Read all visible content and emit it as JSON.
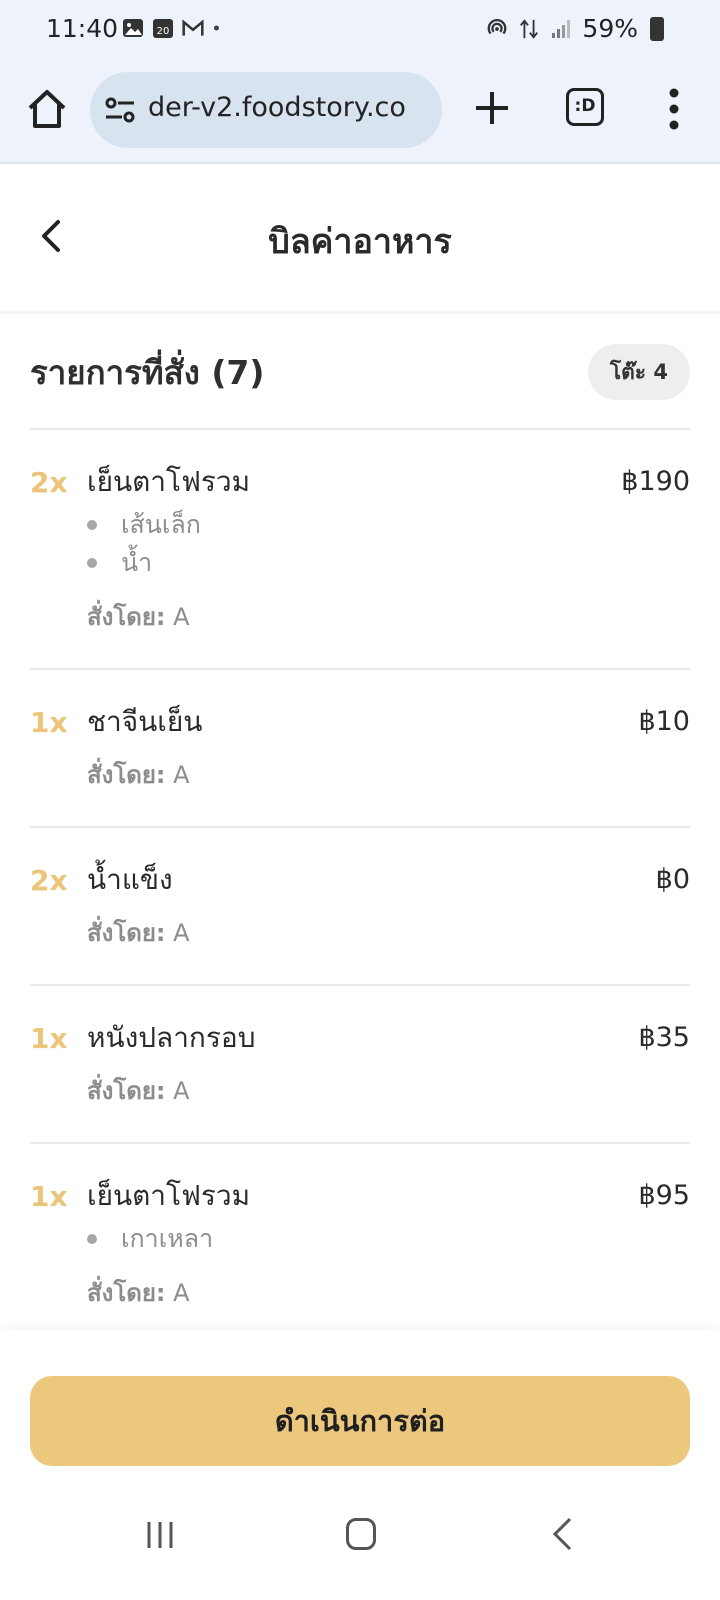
{
  "status_bar": {
    "time": "11:40",
    "left_icons": [
      "gallery-icon",
      "calendar-icon",
      "gmail-icon",
      "dot-icon"
    ],
    "battery_text": "59%",
    "right_icons": [
      "hotspot-icon",
      "data-arrows-icon",
      "signal-icon",
      "battery-icon"
    ]
  },
  "browser": {
    "url": "der-v2.foodstory.co",
    "tabs_label": ":D"
  },
  "header": {
    "title": "บิลค่าอาหาร"
  },
  "order": {
    "title": "รายการที่สั่ง (7)",
    "table_badge": "โต๊ะ 4",
    "ordered_by_label": "สั่งโดย:",
    "items": [
      {
        "qty": "2x",
        "name": "เย็นตาโฟรวม",
        "price": "฿190",
        "options": [
          "เส้นเล็ก",
          "น้ำ"
        ],
        "ordered_by": "A"
      },
      {
        "qty": "1x",
        "name": "ชาจีนเย็น",
        "price": "฿10",
        "options": [],
        "ordered_by": "A"
      },
      {
        "qty": "2x",
        "name": "น้ำแข็ง",
        "price": "฿0",
        "options": [],
        "ordered_by": "A"
      },
      {
        "qty": "1x",
        "name": "หนังปลากรอบ",
        "price": "฿35",
        "options": [],
        "ordered_by": "A"
      },
      {
        "qty": "1x",
        "name": "เย็นตาโฟรวม",
        "price": "฿95",
        "options": [
          "เกาเหลา"
        ],
        "ordered_by": "A"
      }
    ]
  },
  "cta": {
    "label": "ดำเนินการต่อ"
  },
  "colors": {
    "accent": "#ecc87f",
    "qty": "#ebc57a",
    "chrome_bg": "#eef2fb",
    "url_bg": "#d7e3ef"
  }
}
